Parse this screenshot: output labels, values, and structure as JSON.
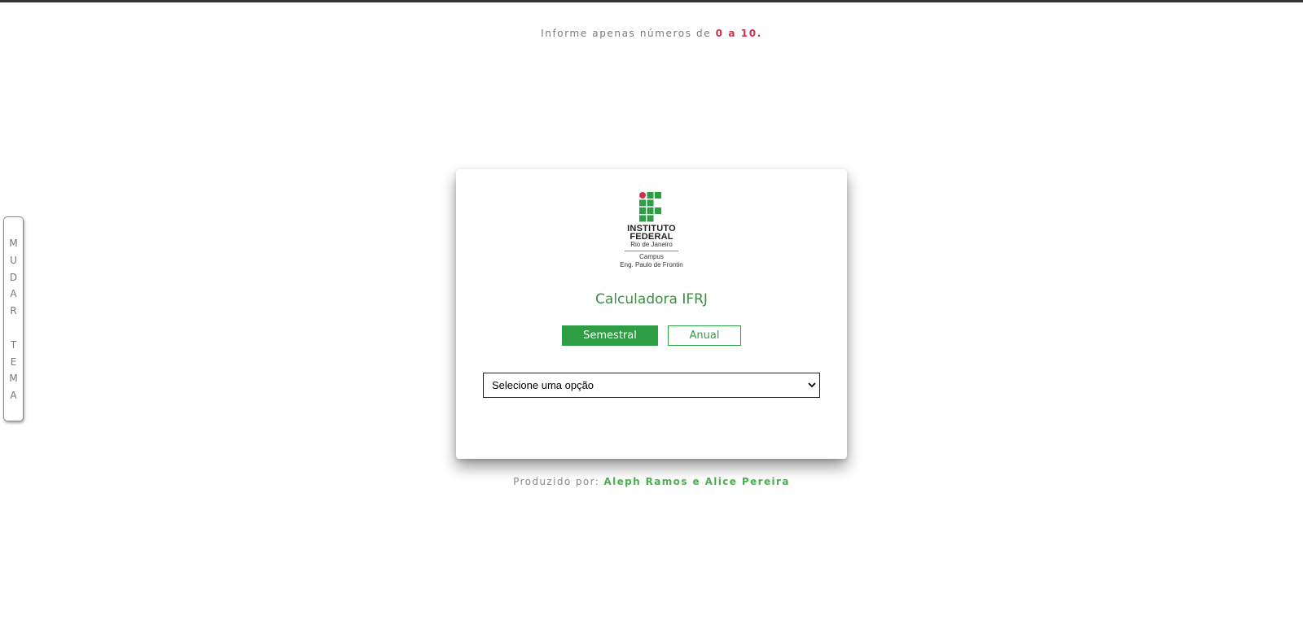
{
  "notice": {
    "prefix": "Informe apenas números de ",
    "range": "0 a 10."
  },
  "theme_toggle": {
    "label": "M\nU\nD\nA\nR\n\nT\nE\nM\nA"
  },
  "logo": {
    "icon": "ifrj-logo-icon",
    "line1": "INSTITUTO",
    "line2": "FEDERAL",
    "line3": "Rio de Janeiro",
    "line4": "Campus",
    "line5": "Eng. Paulo de Frontin",
    "colors": {
      "green": "#2e9e44",
      "red": "#d0314a"
    }
  },
  "card": {
    "title": "Calculadora IFRJ",
    "tabs": {
      "semestral": "Semestral",
      "anual": "Anual"
    },
    "select": {
      "selected": "Selecione uma opção"
    }
  },
  "footer": {
    "prefix": "Produzido por: ",
    "authors": "Aleph Ramos e Alice Pereira"
  },
  "colors": {
    "accent": "#2e9e44",
    "title": "#3b8f43",
    "highlight": "#d0314a"
  }
}
